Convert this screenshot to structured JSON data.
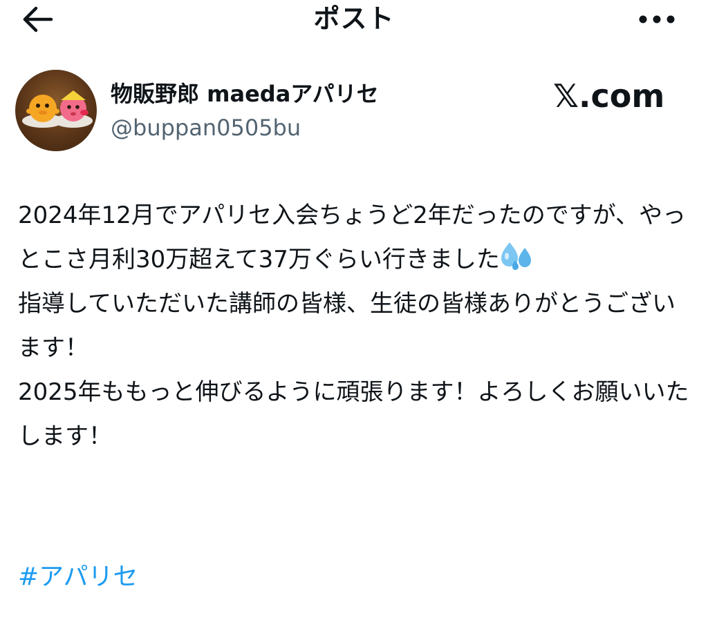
{
  "header": {
    "title": "ポスト",
    "back_icon": "arrow-left-icon",
    "more_icon": "more-horizontal-icon"
  },
  "author": {
    "display_name": "物販野郎 maedaアパリセ",
    "handle": "@buppan0505bu",
    "avatar_icon": "user-avatar"
  },
  "branding": {
    "site": "𝕏.com"
  },
  "post": {
    "text_part1": "2024年12月でアパリセ入会ちょうど2年だったのですが、やっとこさ月利30万超えて37万ぐらい行きました",
    "emoji_icon": "sweat-droplets-icon",
    "text_part2": "\n指導していただいた講師の皆様、生徒の皆様ありがとうございます！\n2025年ももっと伸びるように頑張ります！よろしくお願いいたします！",
    "hashtag": "#アパリセ"
  },
  "colors": {
    "text": "#0f1419",
    "secondary_text": "#536471",
    "link": "#1d9bf0",
    "background": "#ffffff"
  }
}
